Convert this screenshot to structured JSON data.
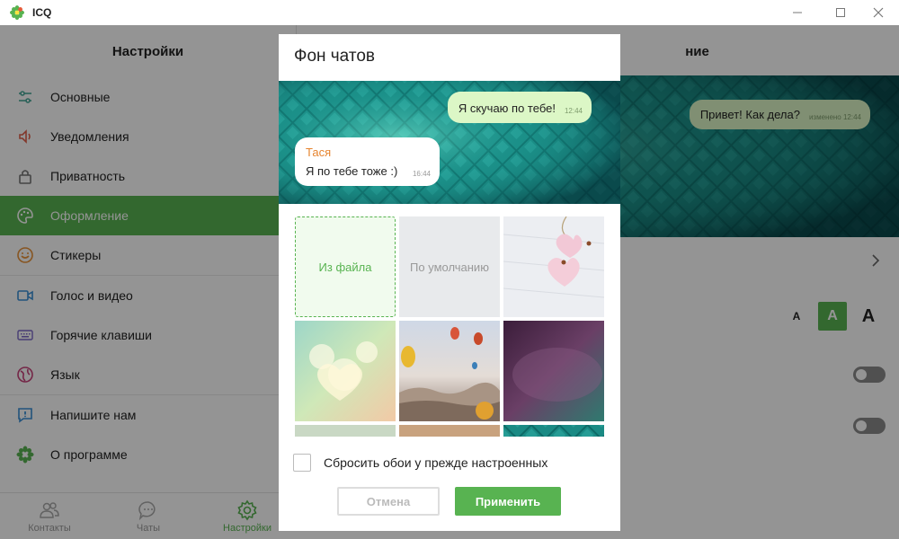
{
  "window": {
    "title": "ICQ"
  },
  "sidebar": {
    "title": "Настройки",
    "groups": [
      [
        {
          "label": "Основные",
          "icon": "sliders-icon"
        },
        {
          "label": "Уведомления",
          "icon": "speaker-icon"
        },
        {
          "label": "Приватность",
          "icon": "lock-icon"
        },
        {
          "label": "Оформление",
          "icon": "palette-icon",
          "active": true
        },
        {
          "label": "Стикеры",
          "icon": "smile-icon"
        }
      ],
      [
        {
          "label": "Голос и видео",
          "icon": "video-camera-icon"
        },
        {
          "label": "Горячие клавиши",
          "icon": "keyboard-icon"
        },
        {
          "label": "Язык",
          "icon": "globe-icon"
        }
      ],
      [
        {
          "label": "Напишите нам",
          "icon": "feedback-icon"
        },
        {
          "label": "О программе",
          "icon": "icq-flower-icon"
        }
      ]
    ]
  },
  "bottom_tabs": [
    {
      "label": "Контакты",
      "icon": "contacts-icon",
      "active": false
    },
    {
      "label": "Чаты",
      "icon": "chat-icon",
      "active": false
    },
    {
      "label": "Настройки",
      "icon": "settings-icon",
      "active": true
    }
  ],
  "right_panel": {
    "title_visible_fragment": "ние",
    "preview_message": "Привет! Как дела?",
    "preview_time": "изменено 12:44",
    "font_sizes": [
      "A",
      "A",
      "A"
    ]
  },
  "dialog": {
    "title": "Фон чатов",
    "preview": {
      "outgoing_text": "Я скучаю по тебе!",
      "outgoing_time": "12:44",
      "incoming_sender": "Тася",
      "incoming_text": "Я по тебе тоже :)",
      "incoming_time": "16:44"
    },
    "tiles": {
      "from_file": "Из файла",
      "default": "По умолчанию"
    },
    "reset_label": "Сбросить обои у прежде настроенных",
    "reset_checked": false,
    "cancel_label": "Отмена",
    "apply_label": "Применить"
  },
  "colors": {
    "accent": "#58b351",
    "bubble_out": "#dcf7c6",
    "sender": "#e6842f"
  }
}
